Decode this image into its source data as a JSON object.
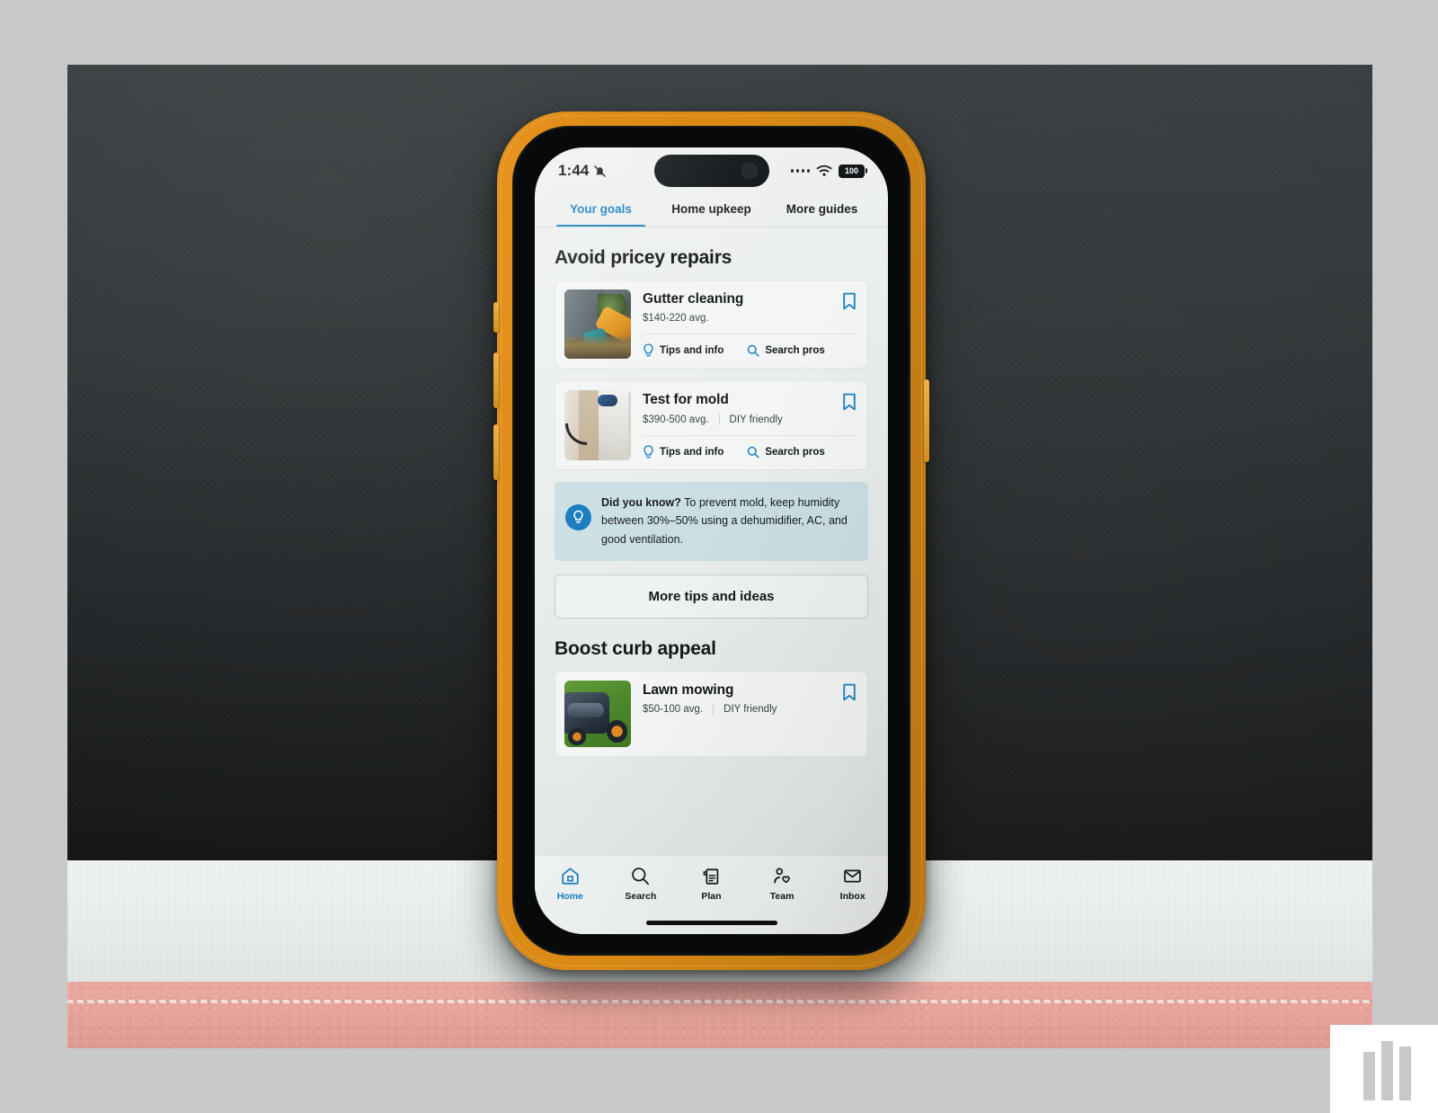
{
  "device": {
    "case_color": "#d98914",
    "status_bar": {
      "time": "1:44",
      "silent_icon": "bell-slash-icon",
      "signal_icon": "signal-dots-icon",
      "wifi_icon": "wifi-icon",
      "battery_level": "100"
    },
    "home_indicator": "home-indicator"
  },
  "accent_color": "#1a7fc1",
  "tabs": [
    {
      "label": "Your goals",
      "active": true
    },
    {
      "label": "Home upkeep",
      "active": false
    },
    {
      "label": "More guides",
      "active": false
    }
  ],
  "sections": [
    {
      "title": "Avoid pricey repairs",
      "cards": [
        {
          "title": "Gutter cleaning",
          "price": "$140-220 avg.",
          "badge": "",
          "thumb": "gutter-cleaning-photo",
          "bookmark_icon": "bookmark-icon",
          "actions": [
            {
              "label": "Tips and info",
              "icon": "lightbulb-icon"
            },
            {
              "label": "Search pros",
              "icon": "search-icon"
            }
          ]
        },
        {
          "title": "Test for mold",
          "price": "$390-500 avg.",
          "badge": "DIY friendly",
          "thumb": "mold-testing-photo",
          "bookmark_icon": "bookmark-icon",
          "actions": [
            {
              "label": "Tips and info",
              "icon": "lightbulb-icon"
            },
            {
              "label": "Search pros",
              "icon": "search-icon"
            }
          ]
        }
      ]
    }
  ],
  "did_you_know": {
    "icon": "lightbulb-icon",
    "lead": "Did you know?",
    "text": " To prevent mold, keep humidity between 30%–50% using a dehumidifier, AC, and good ventilation.",
    "bg_color": "#cadfe4"
  },
  "more_button": {
    "label": "More tips and ideas"
  },
  "section2": {
    "title": "Boost curb appeal",
    "card": {
      "title": "Lawn mowing",
      "price": "$50-100 avg.",
      "badge": "DIY friendly",
      "thumb": "lawn-mowing-photo",
      "bookmark_icon": "bookmark-icon"
    }
  },
  "tabbar": [
    {
      "label": "Home",
      "icon": "home-icon",
      "active": true
    },
    {
      "label": "Search",
      "icon": "search-icon",
      "active": false
    },
    {
      "label": "Plan",
      "icon": "document-icon",
      "active": false
    },
    {
      "label": "Team",
      "icon": "person-heart-icon",
      "active": false
    },
    {
      "label": "Inbox",
      "icon": "envelope-icon",
      "active": false
    }
  ]
}
